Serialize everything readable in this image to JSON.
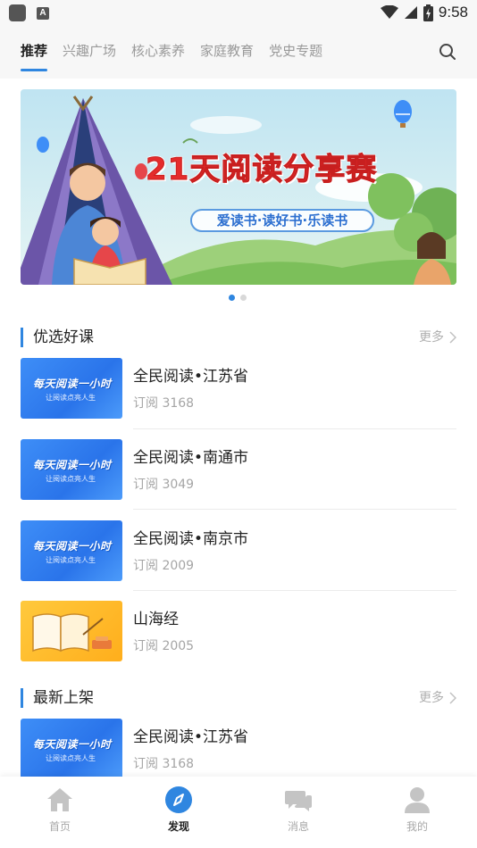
{
  "status_bar": {
    "app_icon_letter": "A",
    "time": "9:58"
  },
  "tabs": [
    {
      "label": "推荐",
      "active": true
    },
    {
      "label": "兴趣广场",
      "active": false
    },
    {
      "label": "核心素养",
      "active": false
    },
    {
      "label": "家庭教育",
      "active": false
    },
    {
      "label": "党史专题",
      "active": false
    }
  ],
  "banner": {
    "title": "21天阅读分享赛",
    "subtitle": "爱读书·读好书·乐读书",
    "page_count": 2,
    "active_page": 1
  },
  "sections": [
    {
      "title": "优选好课",
      "more_label": "更多",
      "items": [
        {
          "title": "全民阅读•江苏省",
          "subtitle": "订阅 3168",
          "thumb_line1": "每天阅读一小时",
          "thumb_line2": "让阅读点亮人生"
        },
        {
          "title": "全民阅读•南通市",
          "subtitle": "订阅 3049",
          "thumb_line1": "每天阅读一小时",
          "thumb_line2": "让阅读点亮人生"
        },
        {
          "title": "全民阅读•南京市",
          "subtitle": "订阅 2009",
          "thumb_line1": "每天阅读一小时",
          "thumb_line2": "让阅读点亮人生"
        },
        {
          "title": "山海经",
          "subtitle": "订阅 2005"
        }
      ]
    },
    {
      "title": "最新上架",
      "more_label": "更多",
      "items": [
        {
          "title": "全民阅读•江苏省",
          "subtitle": "订阅 3168",
          "thumb_line1": "每天阅读一小时",
          "thumb_line2": "让阅读点亮人生"
        }
      ]
    }
  ],
  "bottom_nav": [
    {
      "label": "首页",
      "icon": "home-icon",
      "active": false
    },
    {
      "label": "发现",
      "icon": "compass-icon",
      "active": true
    },
    {
      "label": "消息",
      "icon": "chat-icon",
      "active": false
    },
    {
      "label": "我的",
      "icon": "user-icon",
      "active": false
    }
  ],
  "colors": {
    "accent": "#2f86e0",
    "banner_title": "#e52c2c",
    "muted_text": "#a5a5a5"
  }
}
